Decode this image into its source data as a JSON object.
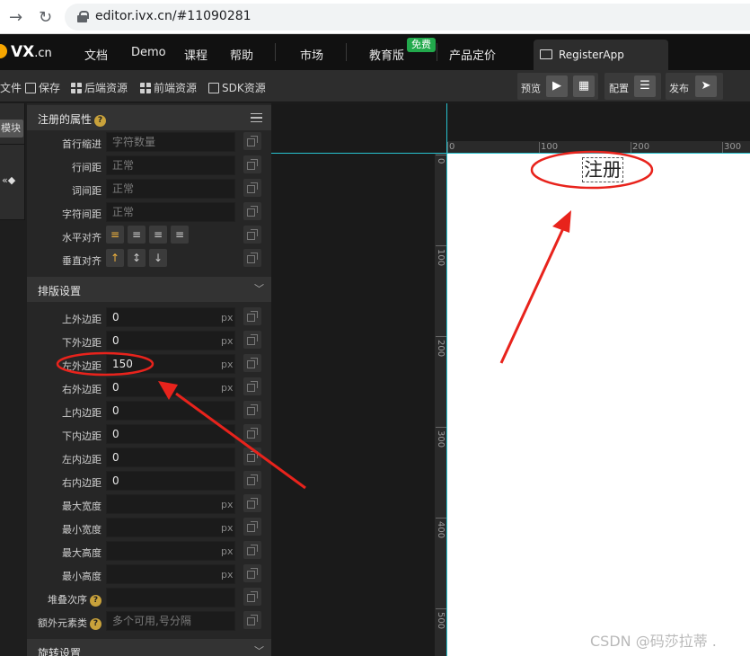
{
  "browser": {
    "url": "editor.ivx.cn/#11090281"
  },
  "topnav": {
    "logo": "VX",
    "logo_suffix": ".cn",
    "items": [
      "文档",
      "Demo",
      "课程",
      "帮助",
      "市场",
      "教育版",
      "产品定价"
    ],
    "badge": "免费",
    "app_tab": "RegisterApp"
  },
  "toolbar": {
    "file": "文件",
    "save": "保存",
    "backend": "后端资源",
    "frontend": "前端资源",
    "sdk": "SDK资源",
    "preview": "预览",
    "config": "配置",
    "publish": "发布"
  },
  "leftstrip": {
    "module": "模块"
  },
  "panel": {
    "section_props": "注册的属性",
    "section_layout": "排版设置",
    "section_rotate": "旋转设置",
    "help_glyph": "?",
    "text_rows": [
      {
        "label": "首行缩进",
        "value": "",
        "placeholder": "字符数量"
      },
      {
        "label": "行间距",
        "value": "",
        "placeholder": "正常"
      },
      {
        "label": "词间距",
        "value": "",
        "placeholder": "正常"
      },
      {
        "label": "字符间距",
        "value": "",
        "placeholder": "正常"
      }
    ],
    "align_h_label": "水平对齐",
    "align_v_label": "垂直对齐",
    "unit": "px",
    "layout_rows": [
      {
        "label": "上外边距",
        "value": "0",
        "unit": true
      },
      {
        "label": "下外边距",
        "value": "0",
        "unit": true
      },
      {
        "label": "左外边距",
        "value": "150",
        "unit": true
      },
      {
        "label": "右外边距",
        "value": "0",
        "unit": true
      },
      {
        "label": "上内边距",
        "value": "0",
        "unit": false
      },
      {
        "label": "下内边距",
        "value": "0",
        "unit": false
      },
      {
        "label": "左内边距",
        "value": "0",
        "unit": false
      },
      {
        "label": "右内边距",
        "value": "0",
        "unit": false
      },
      {
        "label": "最大宽度",
        "value": "",
        "unit": true
      },
      {
        "label": "最小宽度",
        "value": "",
        "unit": true
      },
      {
        "label": "最大高度",
        "value": "",
        "unit": true
      },
      {
        "label": "最小高度",
        "value": "",
        "unit": true
      }
    ],
    "zindex_label": "堆叠次序",
    "extra_class_label": "额外元素类",
    "extra_class_placeholder": "多个可用,号分隔"
  },
  "canvas": {
    "h_ruler": [
      "0",
      "100",
      "200",
      "300"
    ],
    "v_ruler": [
      "0",
      "100",
      "200",
      "300",
      "400",
      "500"
    ],
    "element_text": "注册"
  },
  "watermark": "CSDN @码莎拉蒂 .",
  "colors": {
    "accent_yellow": "#f7a600",
    "badge_green": "#22a94c",
    "guide_cyan": "#27c2cf",
    "annotation_red": "#e8231c"
  }
}
